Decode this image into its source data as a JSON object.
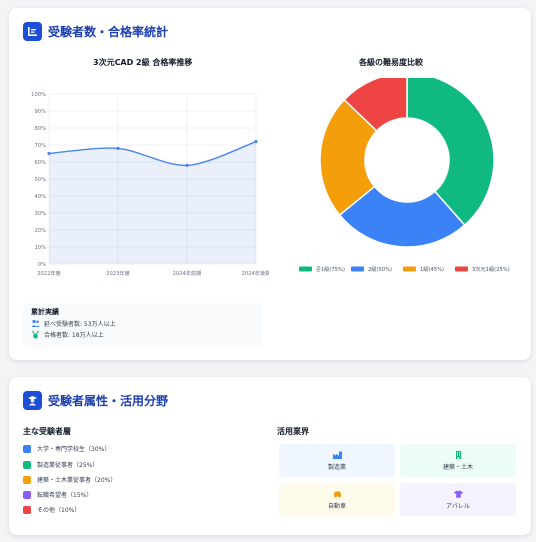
{
  "stats_card": {
    "title": "受験者数・合格率統計",
    "icon": "stats-chart-icon"
  },
  "line_chart_title": "3次元CAD 2級 合格率推移",
  "donut_chart_title": "各級の難易度比較",
  "summary": {
    "title": "累計実績",
    "total_examinees": "延べ受験者数: 53万人以上",
    "total_passers": "合格者数: 18万人以上"
  },
  "demographics_card": {
    "title": "受験者属性・活用分野",
    "icon": "user-graduate-icon"
  },
  "segments": {
    "title": "主な受験者層",
    "items": [
      {
        "label": "大学・専門学校生（30%）",
        "color": "#3b82f6"
      },
      {
        "label": "製造業従事者（25%）",
        "color": "#10b981"
      },
      {
        "label": "建築・土木業従事者（20%）",
        "color": "#f59e0b"
      },
      {
        "label": "転職希望者（15%）",
        "color": "#8b5cf6"
      },
      {
        "label": "その他（10%）",
        "color": "#ef4444"
      }
    ]
  },
  "industries": {
    "title": "活用業界",
    "items": [
      {
        "label": "製造業",
        "icon": "factory-icon",
        "bg": "#eff6ff",
        "color": "#3b82f6"
      },
      {
        "label": "建築・土木",
        "icon": "building-icon",
        "bg": "#ecfdf5",
        "color": "#10b981"
      },
      {
        "label": "自動車",
        "icon": "car-icon",
        "bg": "#fffbeb",
        "color": "#f59e0b"
      },
      {
        "label": "アパレル",
        "icon": "shirt-icon",
        "bg": "#f5f3ff",
        "color": "#8b5cf6"
      }
    ]
  },
  "chart_data": [
    {
      "type": "area",
      "title": "3次元CAD 2級 合格率推移",
      "categories": [
        "2022年度",
        "2023年度",
        "2024年前期",
        "2024年後期"
      ],
      "series": [
        {
          "values": [
            65,
            68,
            58,
            72
          ]
        }
      ],
      "ylim": [
        0,
        100
      ],
      "yticks": [
        "0%",
        "10%",
        "20%",
        "30%",
        "40%",
        "50%",
        "60%",
        "70%",
        "80%",
        "90%",
        "100%"
      ],
      "grid": true,
      "color": "#4a86e8"
    },
    {
      "type": "pie",
      "title": "各級の難易度比較",
      "labels": [
        "준1級(75%)",
        "2級(50%)",
        "1級(45%)",
        "3次元1級(25%)"
      ],
      "values": [
        75,
        50,
        45,
        25
      ],
      "colors": [
        "#10b981",
        "#3b82f6",
        "#f59e0b",
        "#ef4444"
      ],
      "legend": "bottom"
    }
  ]
}
